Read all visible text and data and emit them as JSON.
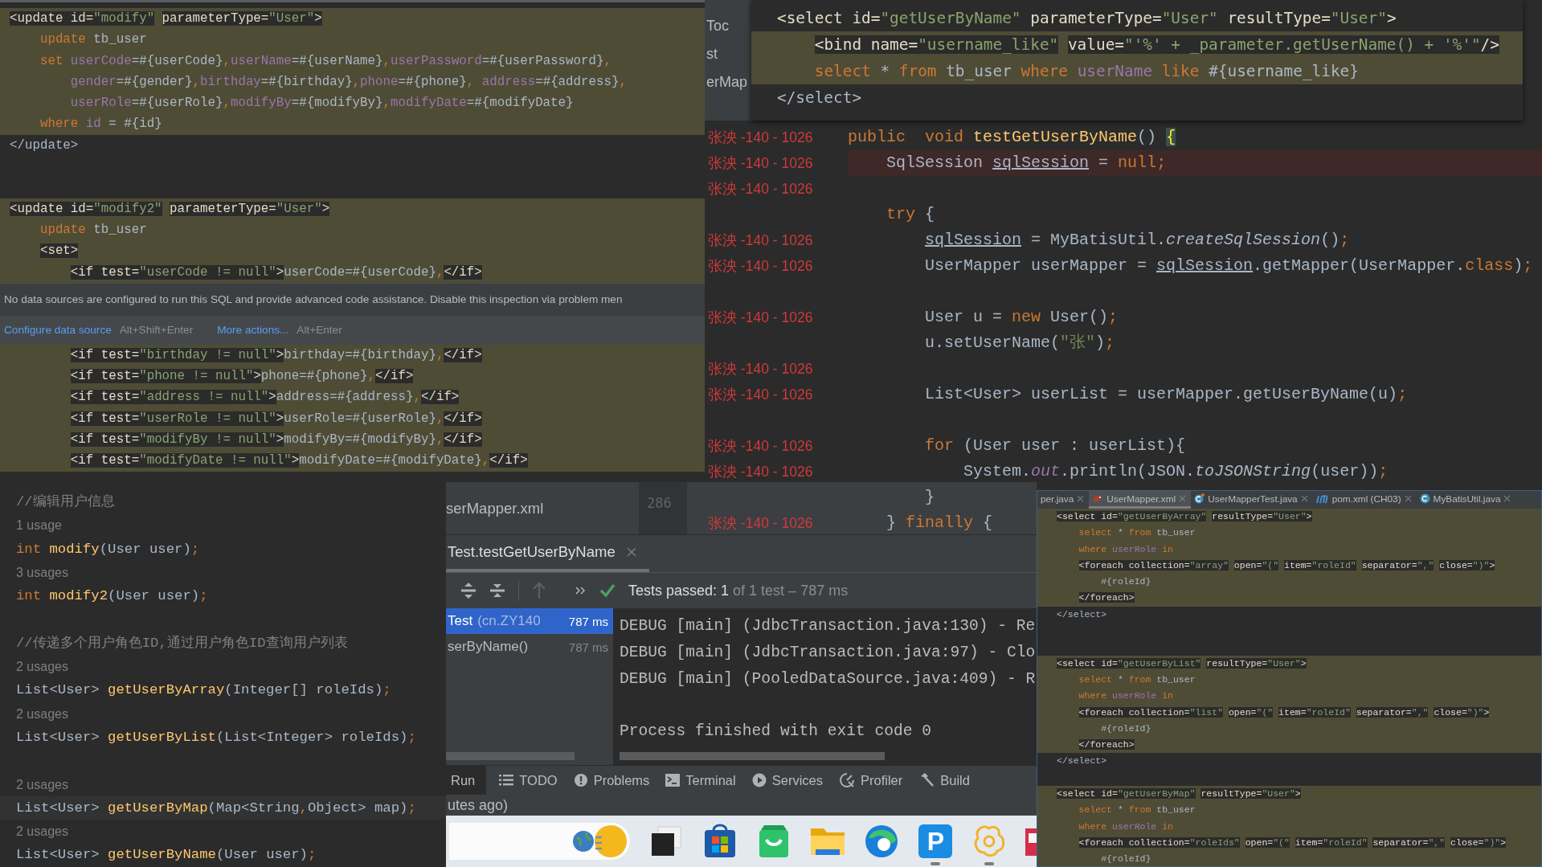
{
  "xml_editor": {
    "lines_before": [
      {
        "kind": "injected",
        "tokens": [
          {
            "text": "<update id=",
            "kind": "tag"
          },
          {
            "text": "\"modify\"",
            "kind": "tagstr"
          },
          {
            "text": " parameterType=",
            "kind": "tag"
          },
          {
            "text": "\"User\"",
            "kind": "tagstr"
          },
          {
            "text": ">",
            "kind": "tag"
          }
        ]
      },
      {
        "kind": "injected",
        "tokens": [
          {
            "text": "    update",
            "kind": "kw"
          },
          {
            "text": " tb_user",
            "kind": "text"
          }
        ]
      },
      {
        "kind": "injected",
        "tokens": [
          {
            "text": "    set",
            "kind": "kw"
          },
          {
            "text": " userCode",
            "kind": "attr"
          },
          {
            "text": "=#{userCode}",
            "kind": "text"
          },
          {
            "text": ",",
            "kind": "kw"
          },
          {
            "text": "userName",
            "kind": "attr"
          },
          {
            "text": "=#{userName}",
            "kind": "text"
          },
          {
            "text": ",",
            "kind": "kw"
          },
          {
            "text": "userPassword",
            "kind": "attr"
          },
          {
            "text": "=#{userPassword}",
            "kind": "text"
          },
          {
            "text": ",",
            "kind": "kw"
          }
        ]
      },
      {
        "kind": "injected",
        "tokens": [
          {
            "text": "        gender",
            "kind": "attr"
          },
          {
            "text": "=#{gender}",
            "kind": "text"
          },
          {
            "text": ",",
            "kind": "kw"
          },
          {
            "text": "birthday",
            "kind": "attr"
          },
          {
            "text": "=#{birthday}",
            "kind": "text"
          },
          {
            "text": ",",
            "kind": "kw"
          },
          {
            "text": "phone",
            "kind": "attr"
          },
          {
            "text": "=#{phone}",
            "kind": "text"
          },
          {
            "text": ", ",
            "kind": "kw"
          },
          {
            "text": "address",
            "kind": "attr"
          },
          {
            "text": "=#{address}",
            "kind": "text"
          },
          {
            "text": ",",
            "kind": "kw"
          }
        ]
      },
      {
        "kind": "injected",
        "tokens": [
          {
            "text": "        userRole",
            "kind": "attr"
          },
          {
            "text": "=#{userRole}",
            "kind": "text"
          },
          {
            "text": ",",
            "kind": "kw"
          },
          {
            "text": "modifyBy",
            "kind": "attr"
          },
          {
            "text": "=#{modifyBy}",
            "kind": "text"
          },
          {
            "text": ",",
            "kind": "kw"
          },
          {
            "text": "modifyDate",
            "kind": "attr"
          },
          {
            "text": "=#{modifyDate}",
            "kind": "text"
          }
        ]
      },
      {
        "kind": "injected",
        "tokens": [
          {
            "text": "    where",
            "kind": "kw"
          },
          {
            "text": " id",
            "kind": "attr"
          },
          {
            "text": " = #{id}",
            "kind": "text"
          }
        ]
      },
      {
        "kind": "plain",
        "tokens": [
          {
            "text": "</update>",
            "kind": "text"
          }
        ]
      },
      {
        "kind": "blank"
      },
      {
        "kind": "blank"
      },
      {
        "kind": "injected",
        "tokens": [
          {
            "text": "<update id=",
            "kind": "tag"
          },
          {
            "text": "\"modify2\"",
            "kind": "tagstr"
          },
          {
            "text": " parameterType=",
            "kind": "tag"
          },
          {
            "text": "\"User\"",
            "kind": "tagstr"
          },
          {
            "text": ">",
            "kind": "tag"
          }
        ]
      },
      {
        "kind": "injected",
        "tokens": [
          {
            "text": "    update",
            "kind": "kw"
          },
          {
            "text": " tb_user",
            "kind": "text"
          }
        ]
      },
      {
        "kind": "injected",
        "tokens": [
          {
            "text": "    <set>",
            "kind": "tag"
          }
        ]
      },
      {
        "kind": "injected",
        "tokens": [
          {
            "text": "        <if test=",
            "kind": "tag"
          },
          {
            "text": "\"userCode != null\"",
            "kind": "tagstr"
          },
          {
            "text": ">",
            "kind": "tag"
          },
          {
            "text": "userCode=#{userCode}",
            "kind": "text"
          },
          {
            "text": ",",
            "kind": "kw"
          },
          {
            "text": "</if>",
            "kind": "tag"
          }
        ]
      }
    ],
    "popup": {
      "message": "No data sources are configured to run this SQL and provide advanced code assistance. Disable this inspection via problem men",
      "actions": [
        {
          "label": "Configure data source",
          "shortcut": "Alt+Shift+Enter"
        },
        {
          "label": "More actions...",
          "shortcut": "Alt+Enter"
        }
      ]
    },
    "lines_after": [
      {
        "kind": "injected",
        "tokens": [
          {
            "text": "        <if test=",
            "kind": "tag"
          },
          {
            "text": "\"birthday != null\"",
            "kind": "tagstr"
          },
          {
            "text": ">",
            "kind": "tag"
          },
          {
            "text": "birthday=#{birthday}",
            "kind": "text"
          },
          {
            "text": ",",
            "kind": "kw"
          },
          {
            "text": "</if>",
            "kind": "tag"
          }
        ]
      },
      {
        "kind": "injected",
        "tokens": [
          {
            "text": "        <if test=",
            "kind": "tag"
          },
          {
            "text": "\"phone != null\"",
            "kind": "tagstr"
          },
          {
            "text": ">",
            "kind": "tag"
          },
          {
            "text": "phone=#{phone}",
            "kind": "text"
          },
          {
            "text": ",",
            "kind": "kw"
          },
          {
            "text": "</if>",
            "kind": "tag"
          }
        ]
      },
      {
        "kind": "injected",
        "tokens": [
          {
            "text": "        <if test=",
            "kind": "tag"
          },
          {
            "text": "\"address != null\"",
            "kind": "tagstr"
          },
          {
            "text": ">",
            "kind": "tag"
          },
          {
            "text": "address=#{address}",
            "kind": "text"
          },
          {
            "text": ",",
            "kind": "kw"
          },
          {
            "text": "</if>",
            "kind": "tag"
          }
        ]
      },
      {
        "kind": "injected",
        "tokens": [
          {
            "text": "        <if test=",
            "kind": "tag"
          },
          {
            "text": "\"userRole != null\"",
            "kind": "tagstr"
          },
          {
            "text": ">",
            "kind": "tag"
          },
          {
            "text": "userRole=#{userRole}",
            "kind": "text"
          },
          {
            "text": ",",
            "kind": "kw"
          },
          {
            "text": "</if>",
            "kind": "tag"
          }
        ]
      },
      {
        "kind": "injected",
        "tokens": [
          {
            "text": "        <if test=",
            "kind": "tag"
          },
          {
            "text": "\"modifyBy != null\"",
            "kind": "tagstr"
          },
          {
            "text": ">",
            "kind": "tag"
          },
          {
            "text": "modifyBy=#{modifyBy}",
            "kind": "text"
          },
          {
            "text": ",",
            "kind": "kw"
          },
          {
            "text": "</if>",
            "kind": "tag"
          }
        ]
      },
      {
        "kind": "injected",
        "tokens": [
          {
            "text": "        <if test=",
            "kind": "tag"
          },
          {
            "text": "\"modifyDate != null\"",
            "kind": "tagstr"
          },
          {
            "text": ">",
            "kind": "tag"
          },
          {
            "text": "modifyDate=#{modifyDate}",
            "kind": "text"
          },
          {
            "text": ",",
            "kind": "kw"
          },
          {
            "text": "</if>",
            "kind": "tag"
          }
        ]
      }
    ]
  },
  "interface_editor": {
    "lines": [
      {
        "kind": "plain",
        "tokens": [
          {
            "text": "//编辑用户信息",
            "kind": "cmt"
          }
        ]
      },
      {
        "kind": "usage",
        "tokens": [
          {
            "text": "1 usage",
            "kind": "usage"
          }
        ]
      },
      {
        "kind": "plain",
        "tokens": [
          {
            "text": "int",
            "kind": "kw"
          },
          {
            "text": " modify",
            "kind": "fn"
          },
          {
            "text": "(User user)",
            "kind": "text"
          },
          {
            "text": ";",
            "kind": "kw"
          }
        ]
      },
      {
        "kind": "usage",
        "tokens": [
          {
            "text": "3 usages",
            "kind": "usage"
          }
        ]
      },
      {
        "kind": "plain",
        "tokens": [
          {
            "text": "int",
            "kind": "kw"
          },
          {
            "text": " modify2",
            "kind": "fn"
          },
          {
            "text": "(User user)",
            "kind": "text"
          },
          {
            "text": ";",
            "kind": "kw"
          }
        ]
      },
      {
        "kind": "blank"
      },
      {
        "kind": "plain",
        "tokens": [
          {
            "text": "//传递多个用户角色ID,通过用户角色ID查询用户列表",
            "kind": "cmt"
          }
        ]
      },
      {
        "kind": "usage",
        "tokens": [
          {
            "text": "2 usages",
            "kind": "usage"
          }
        ]
      },
      {
        "kind": "plain",
        "tokens": [
          {
            "text": "List<User> ",
            "kind": "text"
          },
          {
            "text": "getUserByArray",
            "kind": "fn"
          },
          {
            "text": "(Integer[] roleIds)",
            "kind": "text"
          },
          {
            "text": ";",
            "kind": "kw"
          }
        ]
      },
      {
        "kind": "usage",
        "tokens": [
          {
            "text": "2 usages",
            "kind": "usage"
          }
        ]
      },
      {
        "kind": "plain",
        "tokens": [
          {
            "text": "List<User> ",
            "kind": "text"
          },
          {
            "text": "getUserByList",
            "kind": "fn"
          },
          {
            "text": "(List<Integer> roleIds)",
            "kind": "text"
          },
          {
            "text": ";",
            "kind": "kw"
          }
        ]
      },
      {
        "kind": "blank"
      },
      {
        "kind": "usage",
        "tokens": [
          {
            "text": "2 usages",
            "kind": "usage"
          }
        ]
      },
      {
        "kind": "caret",
        "tokens": [
          {
            "text": "List<User> ",
            "kind": "text"
          },
          {
            "text": "getUserByMap",
            "kind": "fn"
          },
          {
            "text": "(Map<String",
            "kind": "text"
          },
          {
            "text": ",",
            "kind": "kw"
          },
          {
            "text": "Object> map)",
            "kind": "text"
          },
          {
            "text": ";",
            "kind": "kw"
          }
        ]
      },
      {
        "kind": "usage",
        "tokens": [
          {
            "text": "2 usages",
            "kind": "usage"
          }
        ]
      },
      {
        "kind": "plain",
        "tokens": [
          {
            "text": "List<User> ",
            "kind": "text"
          },
          {
            "text": "getUserByName",
            "kind": "fn"
          },
          {
            "text": "(User user)",
            "kind": "text"
          },
          {
            "text": ";",
            "kind": "kw"
          }
        ]
      }
    ]
  },
  "test_editor": {
    "sidebar_fragments": [
      "Toc",
      "st",
      "erMap"
    ],
    "popup_lines": [
      {
        "kind": "plain",
        "tokens": [
          {
            "text": "<select id=",
            "kind": "tag"
          },
          {
            "text": "\"getUserByName\"",
            "kind": "tagstr"
          },
          {
            "text": " parameterType=",
            "kind": "tag"
          },
          {
            "text": "\"User\"",
            "kind": "tagstr"
          },
          {
            "text": " resultType=",
            "kind": "tag"
          },
          {
            "text": "\"User\"",
            "kind": "tagstr"
          },
          {
            "text": ">",
            "kind": "tag"
          }
        ]
      },
      {
        "kind": "injected",
        "tokens": [
          {
            "text": "    <bind name=",
            "kind": "tag"
          },
          {
            "text": "\"username_like\"",
            "kind": "tagstr"
          },
          {
            "text": " value=",
            "kind": "tag"
          },
          {
            "text": "\"'%' + _parameter.getUserName() + '%'\"",
            "kind": "tagstr"
          },
          {
            "text": "/>",
            "kind": "tag"
          }
        ]
      },
      {
        "kind": "injected",
        "tokens": [
          {
            "text": "    select",
            "kind": "kw"
          },
          {
            "text": " * ",
            "kind": "text"
          },
          {
            "text": "from",
            "kind": "kw"
          },
          {
            "text": " tb_user ",
            "kind": "text"
          },
          {
            "text": "where",
            "kind": "kw"
          },
          {
            "text": " userName",
            "kind": "attr"
          },
          {
            "text": " like",
            "kind": "kw"
          },
          {
            "text": " #{username_like}",
            "kind": "text"
          }
        ]
      },
      {
        "kind": "plain",
        "tokens": [
          {
            "text": "</select>",
            "kind": "text"
          }
        ]
      }
    ],
    "rows": [
      {
        "stamp": "张泱 -140 - 1026",
        "kind": "plain",
        "tokens": [
          {
            "text": "public",
            "kind": "kw"
          },
          {
            "text": "  void",
            "kind": "kw"
          },
          {
            "text": " testGetUserByName",
            "kind": "fn"
          },
          {
            "text": "() ",
            "kind": "text"
          },
          {
            "text": "{",
            "kind": "brace"
          }
        ]
      },
      {
        "stamp": "张泱 -140 - 1026",
        "kind": "error",
        "tokens": [
          {
            "text": "    SqlSession ",
            "kind": "text"
          },
          {
            "text": "sqlSession",
            "kind": "under"
          },
          {
            "text": " = ",
            "kind": "text"
          },
          {
            "text": "null",
            "kind": "kw"
          },
          {
            "text": ";",
            "kind": "kw"
          }
        ]
      },
      {
        "stamp": "张泱 -140 - 1026",
        "kind": "blank"
      },
      {
        "kind": "plain",
        "tokens": [
          {
            "text": "    try",
            "kind": "kw"
          },
          {
            "text": " {",
            "kind": "text"
          }
        ]
      },
      {
        "stamp": "张泱 -140 - 1026",
        "kind": "plain",
        "tokens": [
          {
            "text": "        sqlSession",
            "kind": "under"
          },
          {
            "text": " = MyBatisUtil.",
            "kind": "text"
          },
          {
            "text": "createSqlSession",
            "kind": "italic"
          },
          {
            "text": "()",
            "kind": "text"
          },
          {
            "text": ";",
            "kind": "kw"
          }
        ]
      },
      {
        "stamp": "张泱 -140 - 1026",
        "kind": "plain",
        "tokens": [
          {
            "text": "        UserMapper userMapper = ",
            "kind": "text"
          },
          {
            "text": "sqlSession",
            "kind": "under"
          },
          {
            "text": ".getMapper(UserMapper.",
            "kind": "text"
          },
          {
            "text": "class",
            "kind": "kw"
          },
          {
            "text": ")",
            "kind": "text"
          },
          {
            "text": ";",
            "kind": "kw"
          }
        ]
      },
      {
        "kind": "blank"
      },
      {
        "stamp": "张泱 -140 - 1026",
        "kind": "plain",
        "tokens": [
          {
            "text": "        User u = ",
            "kind": "text"
          },
          {
            "text": "new",
            "kind": "kw"
          },
          {
            "text": " User()",
            "kind": "text"
          },
          {
            "text": ";",
            "kind": "kw"
          }
        ]
      },
      {
        "kind": "plain",
        "tokens": [
          {
            "text": "        u.setUserName(",
            "kind": "text"
          },
          {
            "text": "\"张\"",
            "kind": "str"
          },
          {
            "text": ")",
            "kind": "text"
          },
          {
            "text": ";",
            "kind": "kw"
          }
        ]
      },
      {
        "stamp": "张泱 -140 - 1026",
        "kind": "blank"
      },
      {
        "stamp": "张泱 -140 - 1026",
        "kind": "plain",
        "tokens": [
          {
            "text": "        List<User> userList = userMapper.getUserByName(u)",
            "kind": "text"
          },
          {
            "text": ";",
            "kind": "kw"
          }
        ]
      },
      {
        "kind": "blank"
      },
      {
        "stamp": "张泱 -140 - 1026",
        "kind": "plain",
        "tokens": [
          {
            "text": "        for",
            "kind": "kw"
          },
          {
            "text": " (User user : userList){",
            "kind": "text"
          }
        ]
      },
      {
        "stamp": "张泱 -140 - 1026",
        "kind": "plain",
        "tokens": [
          {
            "text": "            System.",
            "kind": "text"
          },
          {
            "text": "out",
            "kind": "field"
          },
          {
            "text": ".println(JSON.",
            "kind": "text"
          },
          {
            "text": "toJSONString",
            "kind": "italic"
          },
          {
            "text": "(user))",
            "kind": "text"
          },
          {
            "text": ";",
            "kind": "kw"
          }
        ]
      },
      {
        "kind": "plain",
        "tokens": [
          {
            "text": "        }",
            "kind": "text"
          }
        ]
      },
      {
        "stamp": "张泱 -140 - 1026",
        "kind": "plain",
        "tokens": [
          {
            "text": "    } ",
            "kind": "text"
          },
          {
            "text": "finally",
            "kind": "kw"
          },
          {
            "text": " {",
            "kind": "text"
          }
        ]
      }
    ]
  },
  "run_panel": {
    "project_item": "serMapper.xml",
    "line_number": "286",
    "tab": {
      "label": "Test.testGetUserByName",
      "selected": true
    },
    "result": {
      "passed": "Tests passed: 1",
      "detail": " of 1 test – 787 ms"
    },
    "tree": [
      {
        "name": "Test",
        "detail": "(cn.ZY140",
        "time": "787 ms",
        "selected": true
      },
      {
        "name": "serByName()",
        "time": "787 ms",
        "selected": false
      }
    ],
    "console": [
      "DEBUG [main] (JdbcTransaction.java:130) - Re",
      "DEBUG [main] (JdbcTransaction.java:97) - Clo",
      "DEBUG [main] (PooledDataSource.java:409) - R"
    ],
    "exit_message": "Process finished with exit code 0",
    "tool_tabs": [
      {
        "label": "Run",
        "selected": true
      },
      {
        "label": "TODO",
        "kind": "todo",
        "selected": false
      },
      {
        "label": "Problems",
        "kind": "problems",
        "selected": false
      },
      {
        "label": "Terminal",
        "kind": "terminal",
        "selected": false
      },
      {
        "label": "Services",
        "kind": "services",
        "selected": false
      },
      {
        "label": "Profiler",
        "kind": "profiler",
        "selected": false
      },
      {
        "label": "Build",
        "kind": "build",
        "selected": false
      }
    ],
    "status_text": "utes ago)"
  },
  "taskbar": {
    "items": [
      {
        "kind": "search"
      },
      {
        "kind": "window",
        "running": false
      },
      {
        "kind": "store",
        "running": false
      },
      {
        "kind": "bag",
        "running": false
      },
      {
        "kind": "folder",
        "running": false
      },
      {
        "kind": "browser",
        "running": false
      },
      {
        "kind": "letter",
        "glyph": "P",
        "running": true
      },
      {
        "kind": "ring",
        "running": true
      },
      {
        "kind": "partial",
        "running": false
      }
    ]
  },
  "mapper_xml": {
    "tabs": [
      {
        "label": "per.java",
        "selected": false
      },
      {
        "label": "UserMapper.xml",
        "kind": "xml",
        "selected": true
      },
      {
        "label": "UserMapperTest.java",
        "kind": "test",
        "selected": false
      },
      {
        "label": "pom.xml (CH03)",
        "kind": "maven",
        "selected": false
      },
      {
        "label": "MyBatisUtil.java",
        "kind": "java",
        "selected": false
      }
    ],
    "lines": [
      {
        "kind": "injected",
        "tokens": [
          {
            "text": "<select id=",
            "kind": "tag"
          },
          {
            "text": "\"getUserByArray\"",
            "kind": "tagstr"
          },
          {
            "text": " resultType=",
            "kind": "tag"
          },
          {
            "text": "\"User\"",
            "kind": "tagstr"
          },
          {
            "text": ">",
            "kind": "tag"
          }
        ]
      },
      {
        "kind": "injected",
        "tokens": [
          {
            "text": "    select",
            "kind": "kw"
          },
          {
            "text": " * ",
            "kind": "text"
          },
          {
            "text": "from",
            "kind": "kw"
          },
          {
            "text": " tb_user",
            "kind": "text"
          }
        ]
      },
      {
        "kind": "injected",
        "tokens": [
          {
            "text": "    where",
            "kind": "kw"
          },
          {
            "text": " userRole",
            "kind": "attr"
          },
          {
            "text": " in",
            "kind": "kw"
          }
        ]
      },
      {
        "kind": "injected",
        "tokens": [
          {
            "text": "    <foreach collection=",
            "kind": "tag"
          },
          {
            "text": "\"array\"",
            "kind": "tagstr"
          },
          {
            "text": " open=",
            "kind": "tag"
          },
          {
            "text": "\"(\"",
            "kind": "tagstr"
          },
          {
            "text": " item=",
            "kind": "tag"
          },
          {
            "text": "\"roleId\"",
            "kind": "tagstr"
          },
          {
            "text": " separator=",
            "kind": "tag"
          },
          {
            "text": "\",\"",
            "kind": "tagstr"
          },
          {
            "text": " close=",
            "kind": "tag"
          },
          {
            "text": "\")\"",
            "kind": "tagstr"
          },
          {
            "text": ">",
            "kind": "tag"
          }
        ]
      },
      {
        "kind": "injected",
        "tokens": [
          {
            "text": "        #{roleId}",
            "kind": "text"
          }
        ]
      },
      {
        "kind": "injected",
        "tokens": [
          {
            "text": "    </foreach>",
            "kind": "tag"
          }
        ]
      },
      {
        "kind": "plain",
        "tokens": [
          {
            "text": "</select>",
            "kind": "text"
          }
        ]
      },
      {
        "kind": "blank"
      },
      {
        "kind": "blank"
      },
      {
        "kind": "injected",
        "tokens": [
          {
            "text": "<select id=",
            "kind": "tag"
          },
          {
            "text": "\"getUserByList\"",
            "kind": "tagstr"
          },
          {
            "text": " resultType=",
            "kind": "tag"
          },
          {
            "text": "\"User\"",
            "kind": "tagstr"
          },
          {
            "text": ">",
            "kind": "tag"
          }
        ]
      },
      {
        "kind": "injected",
        "tokens": [
          {
            "text": "    select",
            "kind": "kw"
          },
          {
            "text": " * ",
            "kind": "text"
          },
          {
            "text": "from",
            "kind": "kw"
          },
          {
            "text": " tb_user",
            "kind": "text"
          }
        ]
      },
      {
        "kind": "injected",
        "tokens": [
          {
            "text": "    where",
            "kind": "kw"
          },
          {
            "text": " userRole",
            "kind": "attr"
          },
          {
            "text": " in",
            "kind": "kw"
          }
        ]
      },
      {
        "kind": "injected",
        "tokens": [
          {
            "text": "    <foreach collection=",
            "kind": "tag"
          },
          {
            "text": "\"list\"",
            "kind": "tagstr"
          },
          {
            "text": " open=",
            "kind": "tag"
          },
          {
            "text": "\"(\"",
            "kind": "tagstr"
          },
          {
            "text": " item=",
            "kind": "tag"
          },
          {
            "text": "\"roleId\"",
            "kind": "tagstr"
          },
          {
            "text": " separator=",
            "kind": "tag"
          },
          {
            "text": "\",\"",
            "kind": "tagstr"
          },
          {
            "text": " close=",
            "kind": "tag"
          },
          {
            "text": "\")\"",
            "kind": "tagstr"
          },
          {
            "text": ">",
            "kind": "tag"
          }
        ]
      },
      {
        "kind": "injected",
        "tokens": [
          {
            "text": "        #{roleId}",
            "kind": "text"
          }
        ]
      },
      {
        "kind": "injected",
        "tokens": [
          {
            "text": "    </foreach>",
            "kind": "tag"
          }
        ]
      },
      {
        "kind": "plain",
        "tokens": [
          {
            "text": "</select>",
            "kind": "text"
          }
        ]
      },
      {
        "kind": "blank"
      },
      {
        "kind": "injected",
        "tokens": [
          {
            "text": "<select id=",
            "kind": "tag"
          },
          {
            "text": "\"getUserByMap\"",
            "kind": "tagstr"
          },
          {
            "text": " resultType=",
            "kind": "tag"
          },
          {
            "text": "\"User\"",
            "kind": "tagstr"
          },
          {
            "text": ">",
            "kind": "tag"
          }
        ]
      },
      {
        "kind": "injected",
        "tokens": [
          {
            "text": "    select",
            "kind": "kw"
          },
          {
            "text": " * ",
            "kind": "text"
          },
          {
            "text": "from",
            "kind": "kw"
          },
          {
            "text": " tb_user",
            "kind": "text"
          }
        ]
      },
      {
        "kind": "injected",
        "tokens": [
          {
            "text": "    where",
            "kind": "kw"
          },
          {
            "text": " userRole",
            "kind": "attr"
          },
          {
            "text": " in",
            "kind": "kw"
          }
        ]
      },
      {
        "kind": "injected",
        "tokens": [
          {
            "text": "    <foreach collection=",
            "kind": "tag"
          },
          {
            "text": "\"roleIds\"",
            "kind": "tagstr"
          },
          {
            "text": " open=",
            "kind": "tag"
          },
          {
            "text": "\"(\"",
            "kind": "tagstr"
          },
          {
            "text": " item=",
            "kind": "tag"
          },
          {
            "text": "\"roleId\"",
            "kind": "tagstr"
          },
          {
            "text": " separator=",
            "kind": "tag"
          },
          {
            "text": "\",\"",
            "kind": "tagstr"
          },
          {
            "text": " close=",
            "kind": "tag"
          },
          {
            "text": "\")\"",
            "kind": "tagstr"
          },
          {
            "text": ">",
            "kind": "tag"
          }
        ]
      },
      {
        "kind": "injected",
        "tokens": [
          {
            "text": "        #{roleId}",
            "kind": "text"
          }
        ]
      }
    ]
  }
}
